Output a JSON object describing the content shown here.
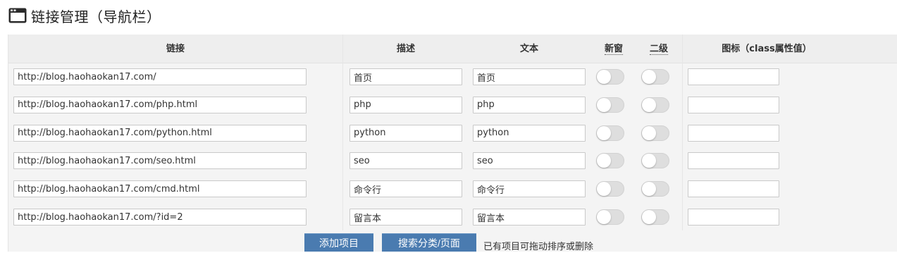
{
  "page": {
    "title": "链接管理（导航栏）"
  },
  "table": {
    "headers": {
      "link": "链接",
      "description": "描述",
      "text": "文本",
      "new_window": "新窗",
      "second_level": "二级",
      "icon": "图标（class属性值）"
    },
    "rows": [
      {
        "link": "http://blog.haohaokan17.com/",
        "description": "首页",
        "text": "首页",
        "new_window": false,
        "second_level": false,
        "icon": ""
      },
      {
        "link": "http://blog.haohaokan17.com/php.html",
        "description": "php",
        "text": "php",
        "new_window": false,
        "second_level": false,
        "icon": ""
      },
      {
        "link": "http://blog.haohaokan17.com/python.html",
        "description": "python",
        "text": "python",
        "new_window": false,
        "second_level": false,
        "icon": ""
      },
      {
        "link": "http://blog.haohaokan17.com/seo.html",
        "description": "seo",
        "text": "seo",
        "new_window": false,
        "second_level": false,
        "icon": ""
      },
      {
        "link": "http://blog.haohaokan17.com/cmd.html",
        "description": "命令行",
        "text": "命令行",
        "new_window": false,
        "second_level": false,
        "icon": ""
      },
      {
        "link": "http://blog.haohaokan17.com/?id=2",
        "description": "留言本",
        "text": "留言本",
        "new_window": false,
        "second_level": false,
        "icon": ""
      }
    ]
  },
  "footer": {
    "add_button": "添加项目",
    "search_button": "搜索分类/页面",
    "note": "已有项目可拖动排序或删除"
  },
  "icons": {
    "title_icon": "browser-window-icon"
  },
  "colors": {
    "button_bg": "#4a7bb0",
    "toggle_off": "#dedede"
  }
}
